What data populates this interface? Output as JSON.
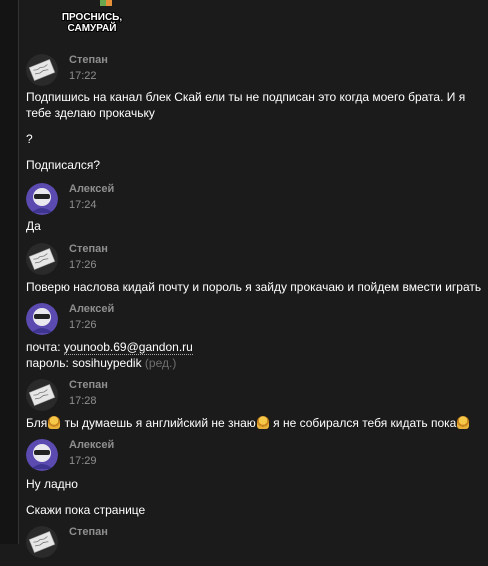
{
  "sticker": {
    "text": [
      "ПРОСНИСЬ,",
      "САМУРАЙ"
    ]
  },
  "messages": [
    {
      "author": "Степан",
      "time": "17:22",
      "lines": [
        "Подпишись на канал блек Скай ели ты не подписан это когда моего брата. И я тебе зделаю прокачьку",
        "?",
        "Подписался?"
      ]
    },
    {
      "author": "Алексей",
      "time": "17:24",
      "lines": [
        "Да"
      ]
    },
    {
      "author": "Степан",
      "time": "17:26",
      "lines": [
        "Поверю наслова кидай почту и пороль я зайду прокачаю и пойдем вмести играть"
      ]
    },
    {
      "author": "Алексей",
      "time": "17:26",
      "email_label": "почта:",
      "email": "younoob.69@gandon.ru",
      "password_label": "пароль:",
      "password": "sosihuypedik",
      "edited": "(ред.)"
    },
    {
      "author": "Степан",
      "time": "17:28",
      "parts": [
        "Бля",
        "ты думаешь я английский не знаю",
        "я не собирался тебя кидать пока"
      ]
    },
    {
      "author": "Алексей",
      "time": "17:29",
      "lines": [
        "Ну ладно",
        "Скажи пока странице"
      ]
    },
    {
      "author": "Степан",
      "time": ""
    }
  ],
  "icons": {
    "reaction_emoji": "person-blonde-emoji",
    "stepan_avatar": "scribble-note-icon",
    "aleksei_avatar": "masked-character-icon"
  },
  "colors": {
    "background": "#1b1b1b",
    "meta_text": "#8f8f8f",
    "text": "#ffffff",
    "edited": "#6f6f6f"
  }
}
